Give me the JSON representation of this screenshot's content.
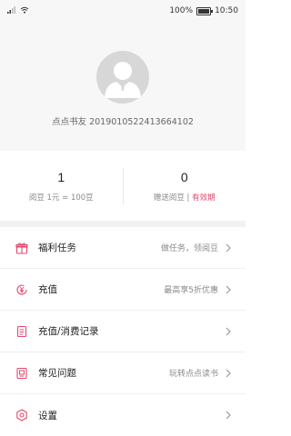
{
  "status_bar": {
    "battery": "100%",
    "battery_level": 1.0,
    "time": "10:50"
  },
  "profile": {
    "username": "点点书友 2019010522413664102"
  },
  "stats": {
    "beans": {
      "value": "1",
      "label": "阅豆 1元 = 100豆"
    },
    "gift_beans": {
      "value": "0",
      "label": "赠送阅豆 | ",
      "label_accent": "有效期"
    }
  },
  "menu": {
    "items": [
      {
        "label": "福利任务",
        "extra": "做任务，领阅豆",
        "icon": "gift-icon"
      },
      {
        "label": "充值",
        "extra": "最高享5折优惠",
        "icon": "yuan-coin-icon"
      },
      {
        "label": "充值/消费记录",
        "extra": "",
        "icon": "record-icon"
      },
      {
        "label": "常见问题",
        "extra": "玩转点点读书",
        "icon": "help-icon"
      },
      {
        "label": "设置",
        "extra": "",
        "icon": "settings-icon"
      }
    ]
  },
  "colors": {
    "accent": "#e24a6f"
  }
}
